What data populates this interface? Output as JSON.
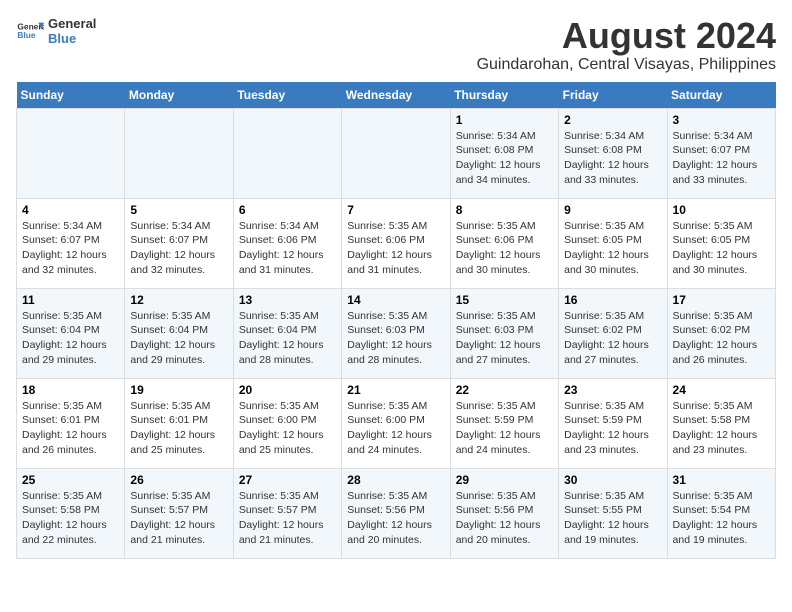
{
  "logo": {
    "text_general": "General",
    "text_blue": "Blue"
  },
  "title": "August 2024",
  "subtitle": "Guindarohan, Central Visayas, Philippines",
  "header_days": [
    "Sunday",
    "Monday",
    "Tuesday",
    "Wednesday",
    "Thursday",
    "Friday",
    "Saturday"
  ],
  "weeks": [
    [
      {
        "day": "",
        "info": ""
      },
      {
        "day": "",
        "info": ""
      },
      {
        "day": "",
        "info": ""
      },
      {
        "day": "",
        "info": ""
      },
      {
        "day": "1",
        "info": "Sunrise: 5:34 AM\nSunset: 6:08 PM\nDaylight: 12 hours\nand 34 minutes."
      },
      {
        "day": "2",
        "info": "Sunrise: 5:34 AM\nSunset: 6:08 PM\nDaylight: 12 hours\nand 33 minutes."
      },
      {
        "day": "3",
        "info": "Sunrise: 5:34 AM\nSunset: 6:07 PM\nDaylight: 12 hours\nand 33 minutes."
      }
    ],
    [
      {
        "day": "4",
        "info": "Sunrise: 5:34 AM\nSunset: 6:07 PM\nDaylight: 12 hours\nand 32 minutes."
      },
      {
        "day": "5",
        "info": "Sunrise: 5:34 AM\nSunset: 6:07 PM\nDaylight: 12 hours\nand 32 minutes."
      },
      {
        "day": "6",
        "info": "Sunrise: 5:34 AM\nSunset: 6:06 PM\nDaylight: 12 hours\nand 31 minutes."
      },
      {
        "day": "7",
        "info": "Sunrise: 5:35 AM\nSunset: 6:06 PM\nDaylight: 12 hours\nand 31 minutes."
      },
      {
        "day": "8",
        "info": "Sunrise: 5:35 AM\nSunset: 6:06 PM\nDaylight: 12 hours\nand 30 minutes."
      },
      {
        "day": "9",
        "info": "Sunrise: 5:35 AM\nSunset: 6:05 PM\nDaylight: 12 hours\nand 30 minutes."
      },
      {
        "day": "10",
        "info": "Sunrise: 5:35 AM\nSunset: 6:05 PM\nDaylight: 12 hours\nand 30 minutes."
      }
    ],
    [
      {
        "day": "11",
        "info": "Sunrise: 5:35 AM\nSunset: 6:04 PM\nDaylight: 12 hours\nand 29 minutes."
      },
      {
        "day": "12",
        "info": "Sunrise: 5:35 AM\nSunset: 6:04 PM\nDaylight: 12 hours\nand 29 minutes."
      },
      {
        "day": "13",
        "info": "Sunrise: 5:35 AM\nSunset: 6:04 PM\nDaylight: 12 hours\nand 28 minutes."
      },
      {
        "day": "14",
        "info": "Sunrise: 5:35 AM\nSunset: 6:03 PM\nDaylight: 12 hours\nand 28 minutes."
      },
      {
        "day": "15",
        "info": "Sunrise: 5:35 AM\nSunset: 6:03 PM\nDaylight: 12 hours\nand 27 minutes."
      },
      {
        "day": "16",
        "info": "Sunrise: 5:35 AM\nSunset: 6:02 PM\nDaylight: 12 hours\nand 27 minutes."
      },
      {
        "day": "17",
        "info": "Sunrise: 5:35 AM\nSunset: 6:02 PM\nDaylight: 12 hours\nand 26 minutes."
      }
    ],
    [
      {
        "day": "18",
        "info": "Sunrise: 5:35 AM\nSunset: 6:01 PM\nDaylight: 12 hours\nand 26 minutes."
      },
      {
        "day": "19",
        "info": "Sunrise: 5:35 AM\nSunset: 6:01 PM\nDaylight: 12 hours\nand 25 minutes."
      },
      {
        "day": "20",
        "info": "Sunrise: 5:35 AM\nSunset: 6:00 PM\nDaylight: 12 hours\nand 25 minutes."
      },
      {
        "day": "21",
        "info": "Sunrise: 5:35 AM\nSunset: 6:00 PM\nDaylight: 12 hours\nand 24 minutes."
      },
      {
        "day": "22",
        "info": "Sunrise: 5:35 AM\nSunset: 5:59 PM\nDaylight: 12 hours\nand 24 minutes."
      },
      {
        "day": "23",
        "info": "Sunrise: 5:35 AM\nSunset: 5:59 PM\nDaylight: 12 hours\nand 23 minutes."
      },
      {
        "day": "24",
        "info": "Sunrise: 5:35 AM\nSunset: 5:58 PM\nDaylight: 12 hours\nand 23 minutes."
      }
    ],
    [
      {
        "day": "25",
        "info": "Sunrise: 5:35 AM\nSunset: 5:58 PM\nDaylight: 12 hours\nand 22 minutes."
      },
      {
        "day": "26",
        "info": "Sunrise: 5:35 AM\nSunset: 5:57 PM\nDaylight: 12 hours\nand 21 minutes."
      },
      {
        "day": "27",
        "info": "Sunrise: 5:35 AM\nSunset: 5:57 PM\nDaylight: 12 hours\nand 21 minutes."
      },
      {
        "day": "28",
        "info": "Sunrise: 5:35 AM\nSunset: 5:56 PM\nDaylight: 12 hours\nand 20 minutes."
      },
      {
        "day": "29",
        "info": "Sunrise: 5:35 AM\nSunset: 5:56 PM\nDaylight: 12 hours\nand 20 minutes."
      },
      {
        "day": "30",
        "info": "Sunrise: 5:35 AM\nSunset: 5:55 PM\nDaylight: 12 hours\nand 19 minutes."
      },
      {
        "day": "31",
        "info": "Sunrise: 5:35 AM\nSunset: 5:54 PM\nDaylight: 12 hours\nand 19 minutes."
      }
    ]
  ]
}
